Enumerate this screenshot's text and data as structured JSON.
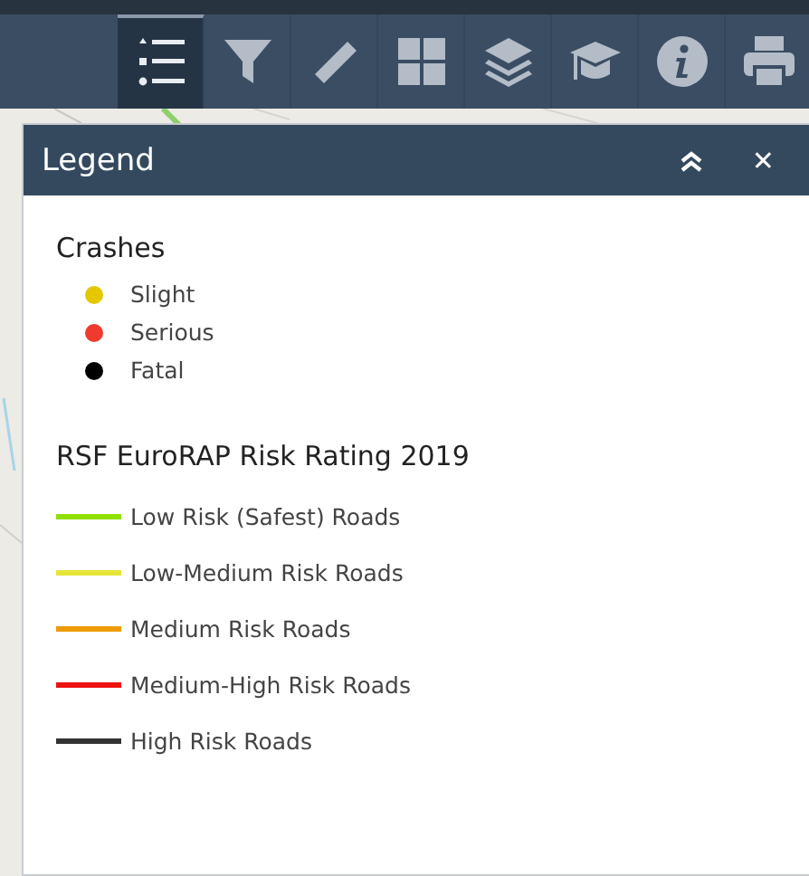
{
  "toolbar": {
    "tools": [
      {
        "kind": "legend",
        "selected": true
      },
      {
        "kind": "filter",
        "selected": false
      },
      {
        "kind": "ruler",
        "selected": false
      },
      {
        "kind": "grid",
        "selected": false
      },
      {
        "kind": "layers",
        "selected": false
      },
      {
        "kind": "cap",
        "selected": false
      },
      {
        "kind": "info",
        "selected": false
      },
      {
        "kind": "print",
        "selected": false
      }
    ]
  },
  "panel": {
    "title": "Legend",
    "close_icon": "✕",
    "sections": [
      {
        "title": "Crashes",
        "items": [
          {
            "kind": "dot",
            "label": "Slight",
            "color": "#e5c700"
          },
          {
            "kind": "dot",
            "label": "Serious",
            "color": "#f03a2e"
          },
          {
            "kind": "dot",
            "label": "Fatal",
            "color": "#000000"
          }
        ]
      },
      {
        "title": "RSF EuroRAP Risk Rating 2019",
        "items": [
          {
            "kind": "line",
            "label": "Low Risk (Safest) Roads",
            "color": "#8fe000"
          },
          {
            "kind": "line",
            "label": "Low-Medium Risk Roads",
            "color": "#e6e63a"
          },
          {
            "kind": "line",
            "label": "Medium Risk Roads",
            "color": "#ee9b00"
          },
          {
            "kind": "line",
            "label": "Medium-High Risk Roads",
            "color": "#ee1111"
          },
          {
            "kind": "line",
            "label": "High Risk Roads",
            "color": "#333333"
          }
        ]
      }
    ]
  }
}
